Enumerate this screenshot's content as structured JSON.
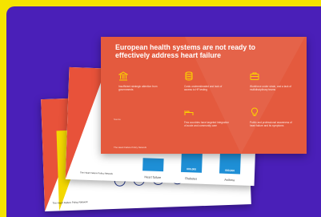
{
  "slide_front": {
    "title": "European health systems are not ready to effectively address heart failure",
    "items": [
      {
        "icon": "bank-icon",
        "text": "Insufficient strategic attention from governments"
      },
      {
        "icon": "coins-icon",
        "text": "Costs underestimated and lack of access to HF testing"
      },
      {
        "icon": "briefcase-icon",
        "text": "Workforce under strain, and a lack of multidisciplinary teams"
      },
      {
        "icon": "bed-icon",
        "text": "Few countries have targeted integration of acute and community care"
      },
      {
        "icon": "lightbulb-icon",
        "text": "Public and professional awareness of heart failure and its symptoms"
      }
    ],
    "source_label": "Source",
    "footer": "The Heart Failure Policy Network"
  },
  "slide_middle": {
    "chart_data": {
      "type": "bar",
      "categories": [
        "Heart failure",
        "Diabetes",
        "Asthma"
      ],
      "values": [
        15,
        22,
        28
      ],
      "value_labels": [
        "",
        "000,000",
        "000,000"
      ]
    },
    "footer": "The Heart Failure Policy Network"
  },
  "slide_back": {
    "icons": [
      "stethoscope-icon",
      "lightbulb-icon",
      "scale-icon",
      "chart-icon",
      "monitor-icon",
      "people-icon",
      "clipboard-icon",
      "globe-icon",
      "pill-icon",
      "heart-icon",
      "hospital-icon"
    ],
    "footer": "The Heart Failure Policy Network"
  },
  "colors": {
    "page": "#f5e300",
    "frame": "#4a1fb8",
    "slide": "#e45a3e",
    "accent": "#fbd300",
    "bar": "#1e8fd6"
  }
}
